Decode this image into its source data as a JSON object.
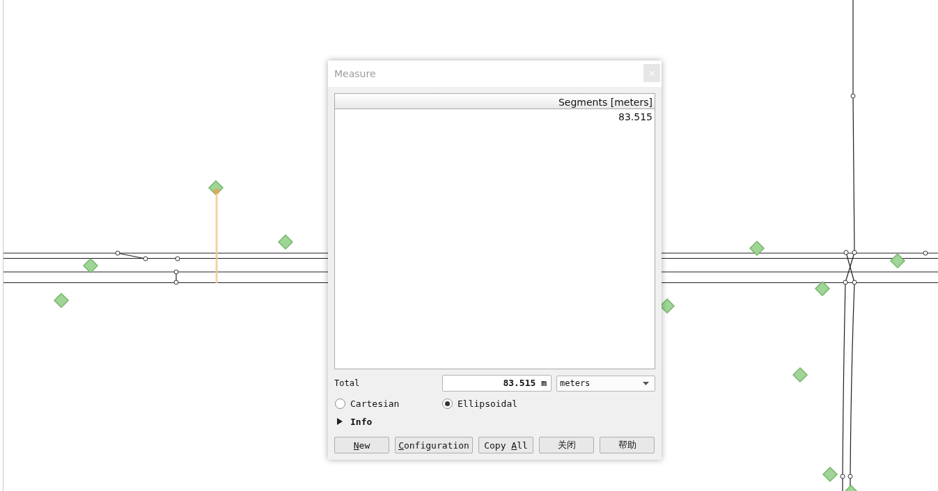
{
  "measure_dialog": {
    "title": "Measure",
    "table": {
      "columns": [
        "Segments [meters]"
      ],
      "rows": [
        [
          "83.515"
        ]
      ]
    },
    "total": {
      "label": "Total",
      "value": "83.515 m",
      "unit": "meters"
    },
    "modes": [
      {
        "label": "Cartesian",
        "selected": false
      },
      {
        "label": "Ellipsoidal",
        "selected": true
      }
    ],
    "info": {
      "label": "Info",
      "expanded": false
    },
    "buttons": [
      {
        "key": "N",
        "after": "ew"
      },
      {
        "key": "C",
        "after": "onfiguration"
      },
      {
        "before": "Copy ",
        "key": "A",
        "after": "ll"
      },
      {
        "before": "关闭"
      },
      {
        "before": "帮助"
      }
    ]
  }
}
